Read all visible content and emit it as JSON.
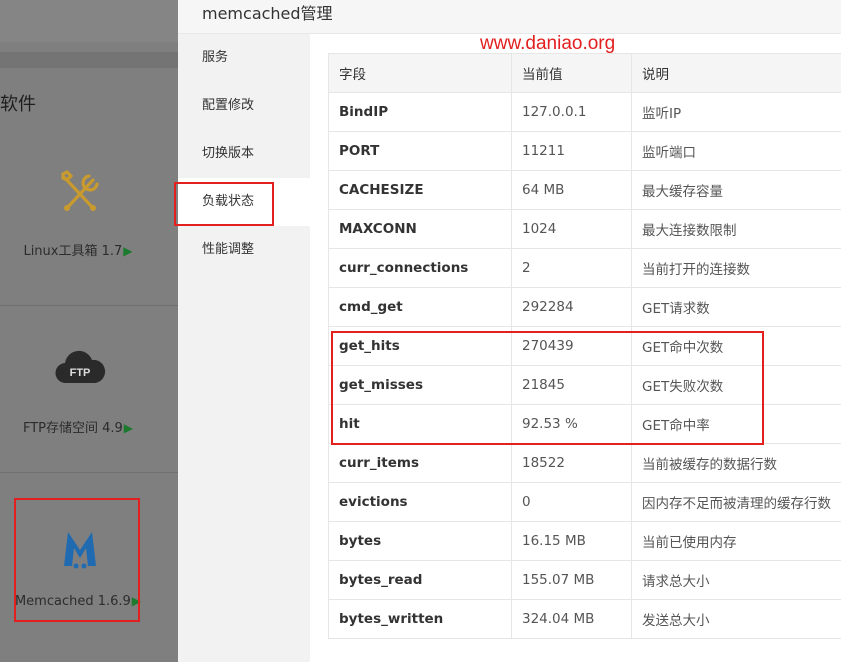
{
  "background": {
    "section_title": "软件",
    "cards": [
      {
        "name": "Linux工具箱 1.7",
        "icon": "tools-icon"
      },
      {
        "name": "FTP存储空间 4.9",
        "icon": "ftp-cloud-icon"
      },
      {
        "name": "Memcached 1.6.9",
        "icon": "memcached-logo-icon"
      }
    ],
    "arrow": "▶"
  },
  "modal": {
    "title": "memcached管理",
    "nav": [
      {
        "label": "服务"
      },
      {
        "label": "配置修改"
      },
      {
        "label": "切换版本"
      },
      {
        "label": "负载状态",
        "active": true
      },
      {
        "label": "性能调整"
      }
    ]
  },
  "watermark": "www.daniao.org",
  "table": {
    "headers": [
      "字段",
      "当前值",
      "说明"
    ],
    "rows": [
      [
        "BindIP",
        "127.0.0.1",
        "监听IP"
      ],
      [
        "PORT",
        "11211",
        "监听端口"
      ],
      [
        "CACHESIZE",
        "64 MB",
        "最大缓存容量"
      ],
      [
        "MAXCONN",
        "1024",
        "最大连接数限制"
      ],
      [
        "curr_connections",
        "2",
        "当前打开的连接数"
      ],
      [
        "cmd_get",
        "292284",
        "GET请求数"
      ],
      [
        "get_hits",
        "270439",
        "GET命中次数"
      ],
      [
        "get_misses",
        "21845",
        "GET失败次数"
      ],
      [
        "hit",
        "92.53 %",
        "GET命中率"
      ],
      [
        "curr_items",
        "18522",
        "当前被缓存的数据行数"
      ],
      [
        "evictions",
        "0",
        "因内存不足而被清理的缓存行数"
      ],
      [
        "bytes",
        "16.15 MB",
        "当前已使用内存"
      ],
      [
        "bytes_read",
        "155.07 MB",
        "请求总大小"
      ],
      [
        "bytes_written",
        "324.04 MB",
        "发送总大小"
      ]
    ]
  },
  "colors": {
    "highlight": "#e1201f",
    "accent_green": "#1b7a2e",
    "tools_gold": "#c99a2e",
    "memcached_blue": "#1f6ab0"
  }
}
